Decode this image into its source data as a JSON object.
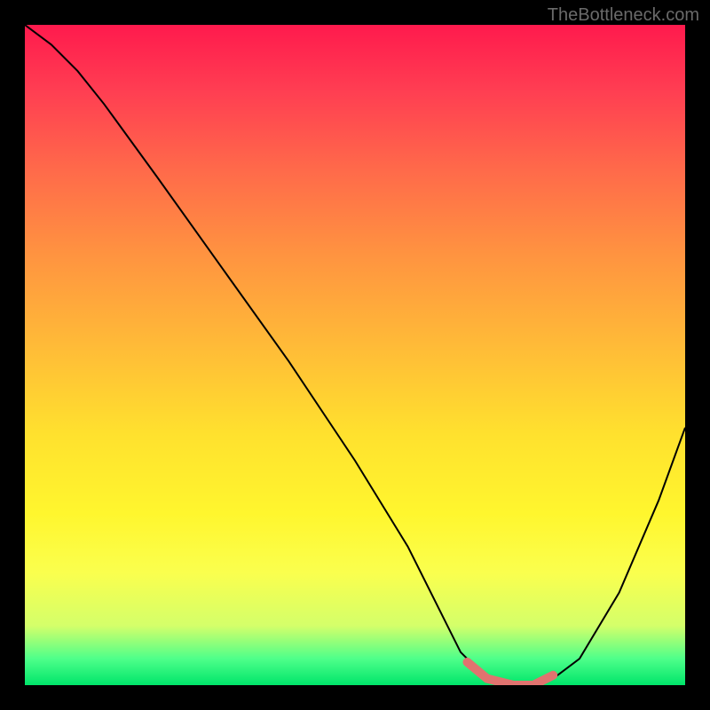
{
  "watermark": "TheBottleneck.com",
  "chart_data": {
    "type": "line",
    "title": "",
    "xlabel": "",
    "ylabel": "",
    "xlim": [
      0,
      100
    ],
    "ylim": [
      0,
      100
    ],
    "series": [
      {
        "name": "bottleneck-curve",
        "x": [
          0,
          4,
          8,
          12,
          20,
          30,
          40,
          50,
          58,
          63,
          66,
          70,
          74,
          77,
          80,
          84,
          90,
          96,
          100
        ],
        "values": [
          100,
          97,
          93,
          88,
          77,
          63,
          49,
          34,
          21,
          11,
          5,
          1,
          0,
          0,
          1,
          4,
          14,
          28,
          39
        ]
      },
      {
        "name": "optimal-range",
        "x": [
          67,
          70,
          74,
          77,
          80
        ],
        "values": [
          3.5,
          1,
          0,
          0,
          1.5
        ]
      }
    ],
    "background_gradient": {
      "top": "#ff1a4d",
      "middle": "#ffe12e",
      "bottom": "#00e56a"
    },
    "highlight_color": "#e0736f",
    "curve_color": "#000000"
  }
}
